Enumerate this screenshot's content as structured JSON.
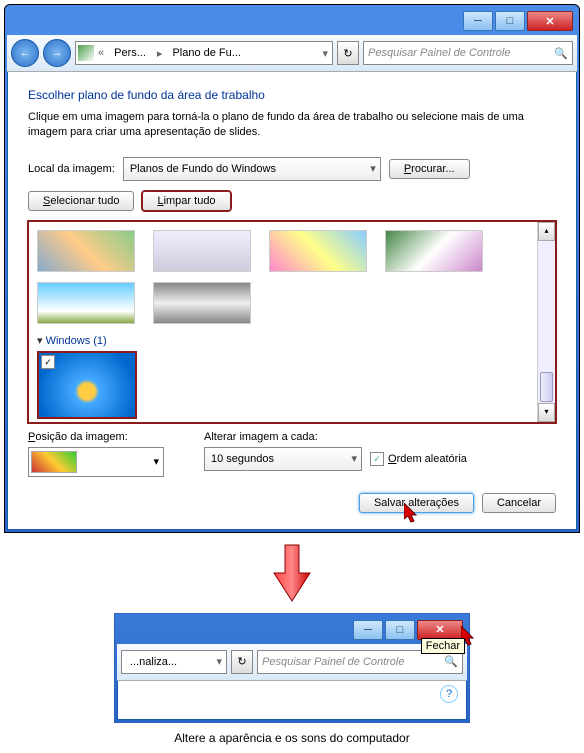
{
  "win1": {
    "nav": {
      "back": "←",
      "fwd": "→",
      "crumb1": "Pers...",
      "crumb2": "Plano de Fu...",
      "search_placeholder": "Pesquisar Painel de Controle"
    },
    "title": "Escolher plano de fundo da área de trabalho",
    "desc": "Clique em uma imagem para torná-la o plano de fundo da área de trabalho ou selecione mais de uma imagem para criar uma apresentação de slides.",
    "loc_label": "Local da imagem:",
    "loc_value": "Planos de Fundo do Windows",
    "browse": "Procurar...",
    "select_all": "Selecionar tudo",
    "clear_all": "Limpar tudo",
    "group": "Windows (1)",
    "pos_label": "Posição da imagem:",
    "interval_label": "Alterar imagem a cada:",
    "interval_value": "10 segundos",
    "shuffle": "Ordem aleatória",
    "save": "Salvar alterações",
    "cancel": "Cancelar"
  },
  "win2": {
    "crumb1": "...naliza...",
    "search_placeholder": "Pesquisar Painel de Controle",
    "tooltip": "Fechar",
    "caption": "Altere a aparência e os sons do computador"
  }
}
